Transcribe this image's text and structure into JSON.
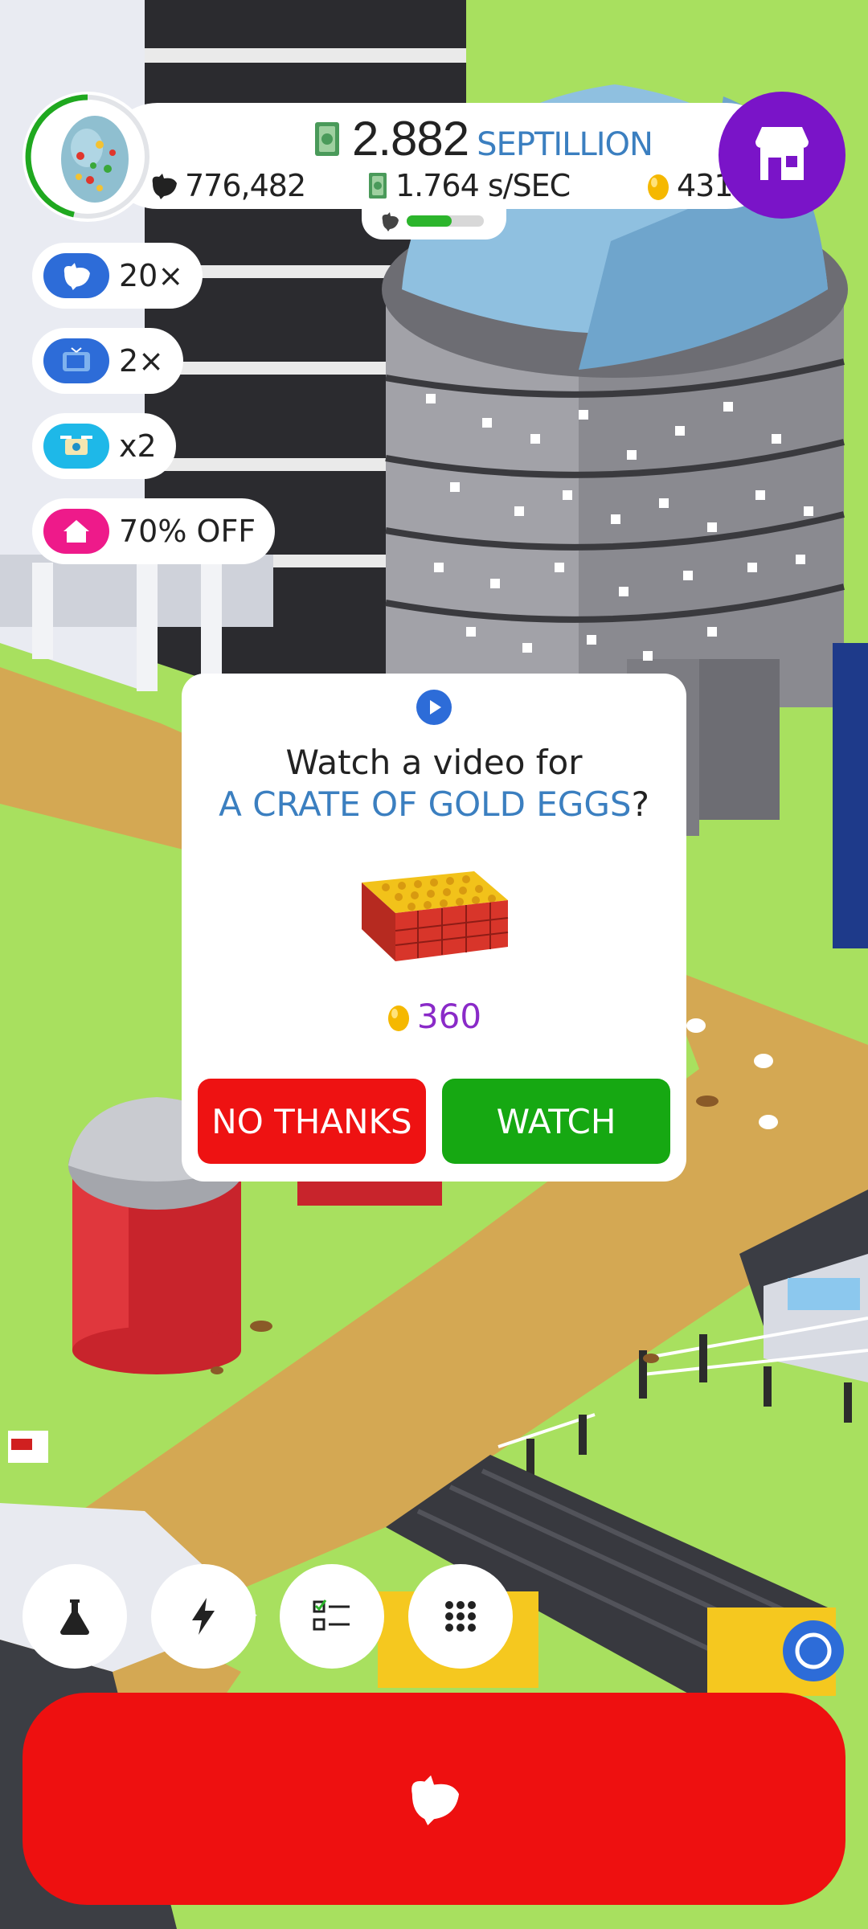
{
  "header": {
    "money_value": "2.882",
    "money_unit": "SEPTILLION",
    "chickens": "776,482",
    "rate": "1.764 s/SEC",
    "gold_eggs": "431",
    "progress_fraction": 0.58,
    "icons": {
      "money": "cash-icon",
      "chicken": "chicken-icon",
      "rate": "cash-icon",
      "gold": "gold-egg-icon",
      "shop": "shop-icon",
      "egg": "egg-icon"
    }
  },
  "boosts": [
    {
      "label": "20×",
      "icon": "chicken-boost-icon",
      "color": "#2d6cd8"
    },
    {
      "label": "2×",
      "icon": "tv-boost-icon",
      "color": "#2d6cd8"
    },
    {
      "label": "x2",
      "icon": "drone-boost-icon",
      "color": "#1eb8e8"
    },
    {
      "label": "70% OFF",
      "icon": "house-discount-icon",
      "color": "#ee1a8a"
    }
  ],
  "dialog": {
    "line1": "Watch a video for",
    "line2_highlight": "A CRATE OF GOLD EGGS",
    "line2_suffix": "?",
    "cost": "360",
    "no_label": "NO THANKS",
    "yes_label": "WATCH",
    "colors": {
      "no": "#ee1212",
      "yes": "#16a812",
      "highlight": "#3b7fc0",
      "cost": "#8a2ac8"
    }
  },
  "nav": {
    "items": [
      "research-flask-icon",
      "boost-lightning-icon",
      "missions-checklist-icon",
      "menu-grid-icon"
    ]
  },
  "colors": {
    "grass": "#a8e05f",
    "shop": "#7a14c8",
    "hatch": "#ee1010"
  }
}
